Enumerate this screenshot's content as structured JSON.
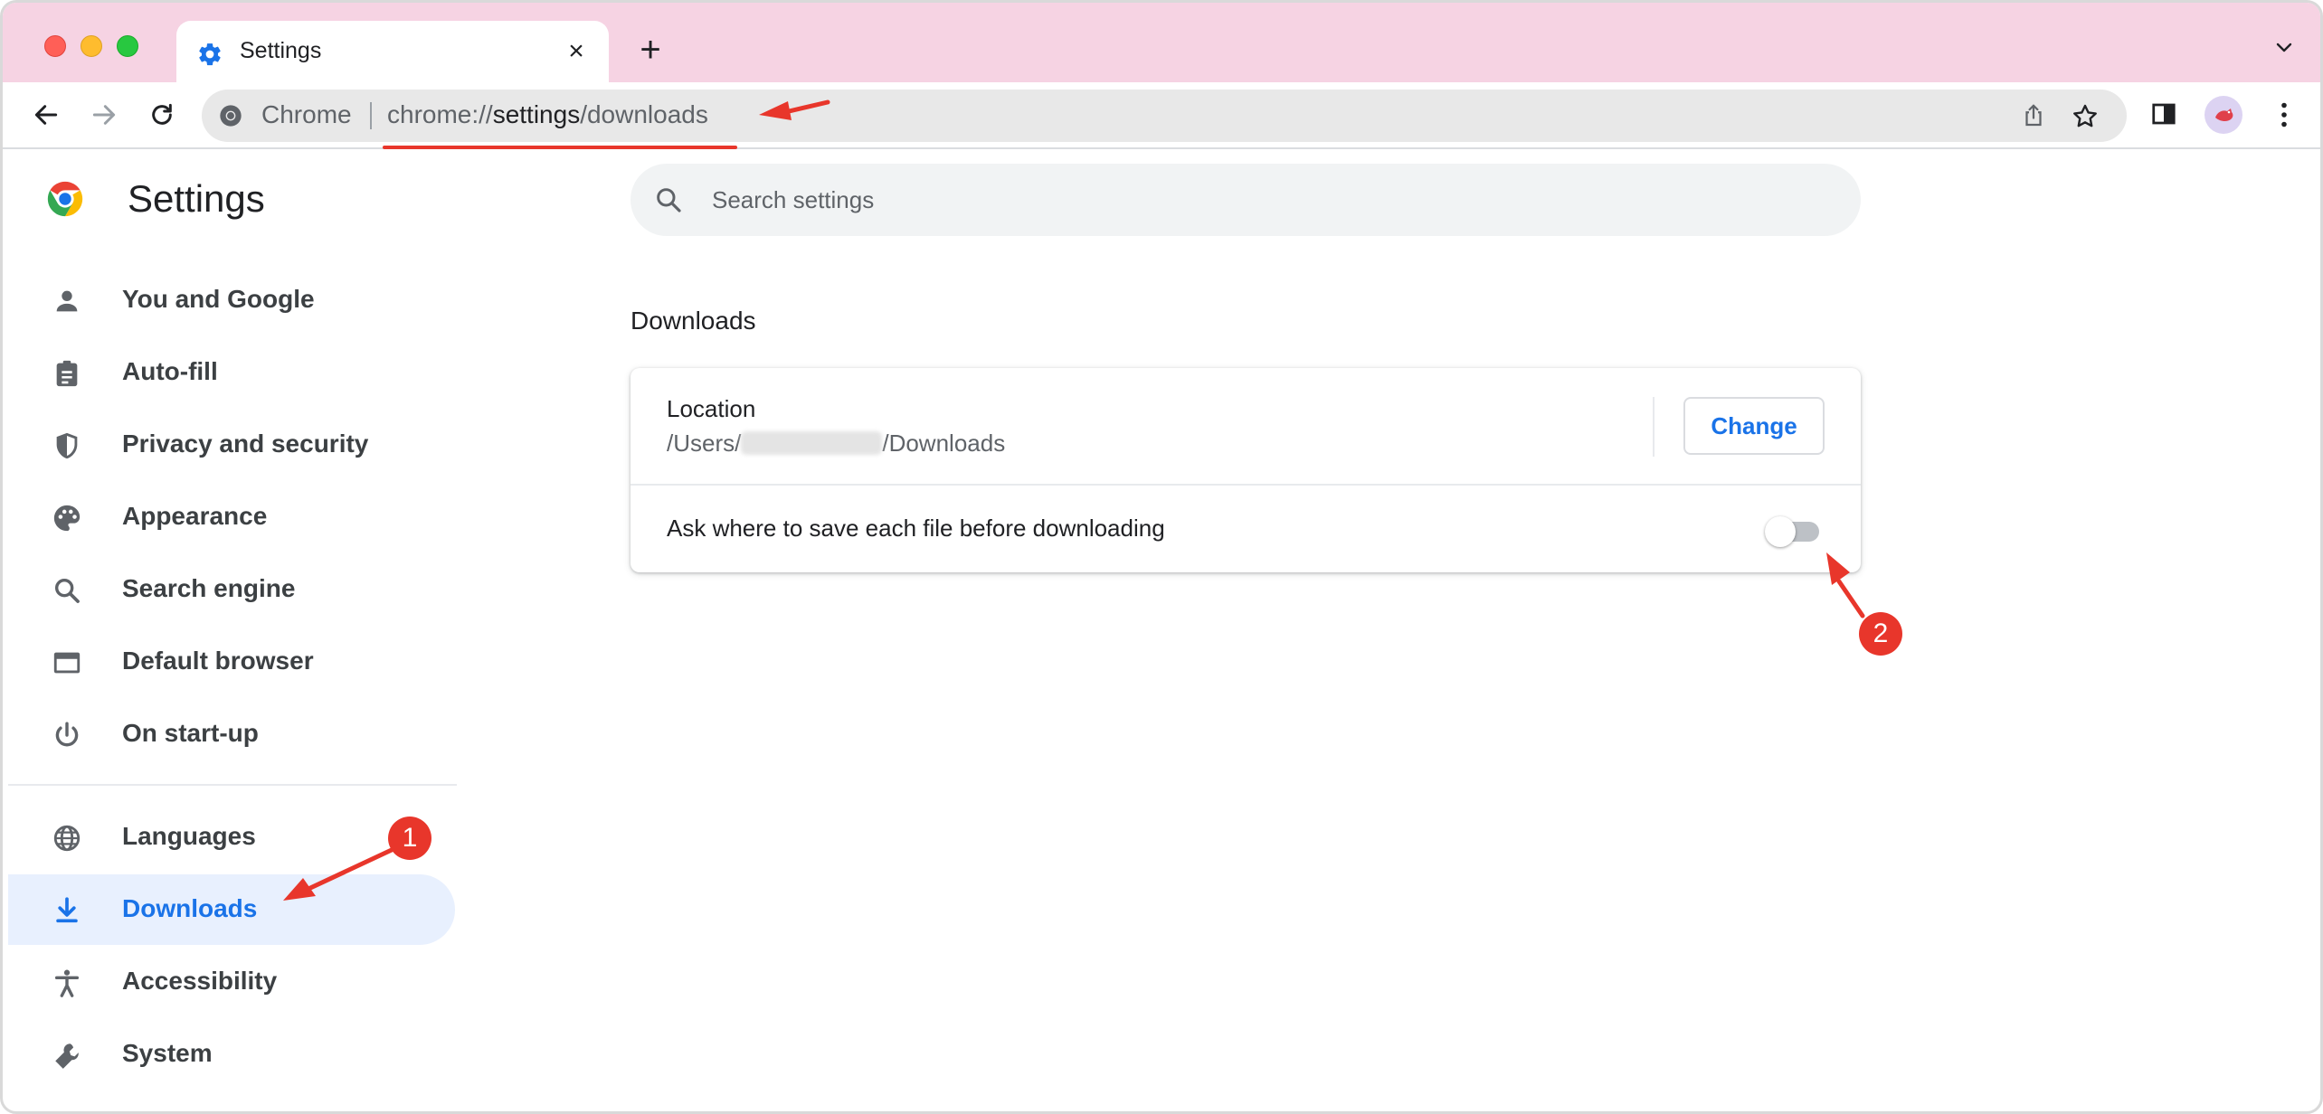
{
  "window": {
    "tab_title": "Settings",
    "tab_close_glyph": "×",
    "new_tab_glyph": "+"
  },
  "toolbar": {
    "omnibox_chip": "Chrome",
    "url_scheme": "chrome://",
    "url_host": "settings",
    "url_path": "/downloads"
  },
  "settings": {
    "title": "Settings",
    "search_placeholder": "Search settings"
  },
  "sidebar": {
    "items": [
      {
        "label": "You and Google",
        "icon": "person-icon"
      },
      {
        "label": "Auto-fill",
        "icon": "clipboard-icon"
      },
      {
        "label": "Privacy and security",
        "icon": "shield-icon"
      },
      {
        "label": "Appearance",
        "icon": "palette-icon"
      },
      {
        "label": "Search engine",
        "icon": "search-icon"
      },
      {
        "label": "Default browser",
        "icon": "browser-window-icon"
      },
      {
        "label": "On start-up",
        "icon": "power-icon"
      },
      {
        "label": "Languages",
        "icon": "globe-icon"
      },
      {
        "label": "Downloads",
        "icon": "download-icon",
        "active": true
      },
      {
        "label": "Accessibility",
        "icon": "accessibility-icon"
      },
      {
        "label": "System",
        "icon": "wrench-icon"
      }
    ]
  },
  "downloads": {
    "section_title": "Downloads",
    "location_label": "Location",
    "location_path_prefix": "/Users/",
    "location_path_suffix": "/Downloads",
    "change_button": "Change",
    "ask_label": "Ask where to save each file before downloading",
    "ask_enabled": false
  },
  "annotations": {
    "badge_1": "1",
    "badge_2": "2",
    "color": "#e8362b"
  },
  "colors": {
    "tabbar": "#f6d3e3",
    "accent": "#1a73e8",
    "active_bg": "#e8f0fe"
  }
}
